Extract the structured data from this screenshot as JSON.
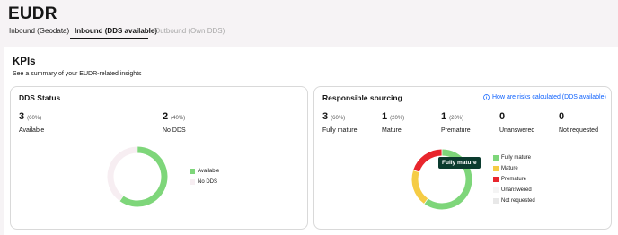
{
  "page": {
    "title": "EUDR"
  },
  "tabs": [
    {
      "label": "Inbound (Geodata)",
      "state": "default"
    },
    {
      "label": "Inbound (DDS available)",
      "state": "active"
    },
    {
      "label": "Outbound (Own DDS)",
      "state": "disabled"
    }
  ],
  "kpis": {
    "title": "KPIs",
    "subtitle": "See a summary of your EUDR-related insights"
  },
  "dds_card": {
    "title": "DDS Status",
    "stats": [
      {
        "value": "3",
        "pct": "(60%)",
        "label": "Available"
      },
      {
        "value": "2",
        "pct": "(40%)",
        "label": "No DDS"
      }
    ],
    "legend": [
      {
        "label": "Available",
        "color": "#7ed67a"
      },
      {
        "label": "No DDS",
        "color": "#f7eef2"
      }
    ]
  },
  "sourcing_card": {
    "title": "Responsible sourcing",
    "link_label": "How are risks calculated (DDS available)",
    "link_icon": "info-icon",
    "stats": [
      {
        "value": "3",
        "pct": "(60%)",
        "label": "Fully mature"
      },
      {
        "value": "1",
        "pct": "(20%)",
        "label": "Mature"
      },
      {
        "value": "1",
        "pct": "(20%)",
        "label": "Premature"
      },
      {
        "value": "0",
        "pct": "",
        "label": "Unanswered"
      },
      {
        "value": "0",
        "pct": "",
        "label": "Not requested"
      }
    ],
    "legend": [
      {
        "label": "Fully mature",
        "color": "#7ed67a"
      },
      {
        "label": "Mature",
        "color": "#f5cc45"
      },
      {
        "label": "Premature",
        "color": "#e8262d"
      },
      {
        "label": "Unanswered",
        "color": "#f4f4f4"
      },
      {
        "label": "Not requested",
        "color": "#e8e8e8"
      }
    ],
    "tooltip": "Fully mature"
  },
  "chart_data": [
    {
      "type": "pie",
      "variant": "donut",
      "categories": [
        "Available",
        "No DDS"
      ],
      "values": [
        3,
        2
      ],
      "colors": [
        "#7ed67a",
        "#f7eef2"
      ]
    },
    {
      "type": "pie",
      "variant": "donut",
      "categories": [
        "Fully mature",
        "Mature",
        "Premature",
        "Unanswered",
        "Not requested"
      ],
      "values": [
        3,
        1,
        1,
        0,
        0
      ],
      "colors": [
        "#7ed67a",
        "#f5cc45",
        "#e8262d",
        "#f4f4f4",
        "#e8e8e8"
      ]
    }
  ]
}
